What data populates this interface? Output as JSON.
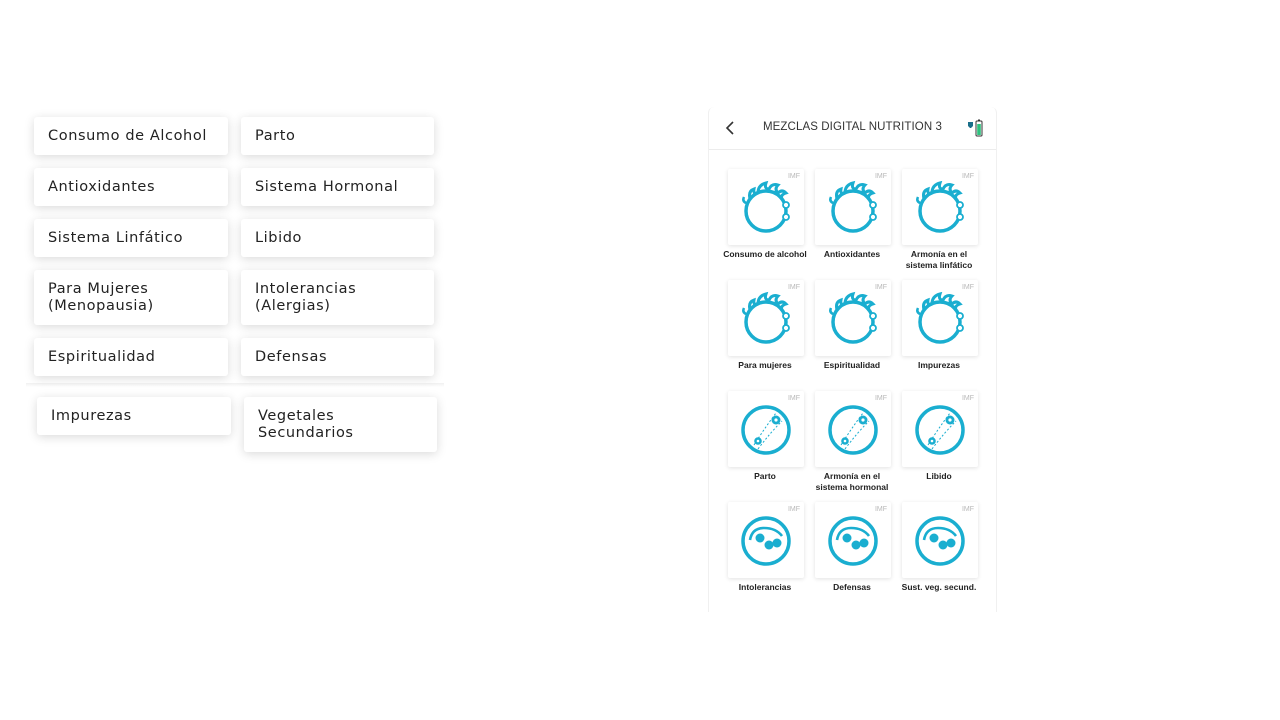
{
  "list_items": [
    {
      "label": "Consumo de Alcohol"
    },
    {
      "label": "Parto"
    },
    {
      "label": "Antioxidantes"
    },
    {
      "label": "Sistema Hormonal"
    },
    {
      "label": "Sistema Linfático"
    },
    {
      "label": "Libido"
    },
    {
      "label": "Para Mujeres\n(Menopausia)"
    },
    {
      "label": "Intolerancias\n(Alergias)"
    },
    {
      "label": "Espiritualidad"
    },
    {
      "label": "Defensas"
    },
    {
      "label": "Impurezas"
    },
    {
      "label": "Vegetales\nSecundarios"
    }
  ],
  "phone": {
    "title": "MEZCLAS DIGITAL NUTRITION 3",
    "back_icon": "chevron-left-icon",
    "device_icon": "bottle-battery-icon",
    "accent_color": "#1aaed0",
    "tiles": [
      {
        "label": "Consumo de alcohol",
        "tag": "IMF",
        "icon": "spiky-circle-icon"
      },
      {
        "label": "Antioxidantes",
        "tag": "IMF",
        "icon": "spiky-circle-icon"
      },
      {
        "label": "Armonía en el\nsistema linfático",
        "tag": "IMF",
        "icon": "spiky-circle-icon"
      },
      {
        "label": "Para mujeres",
        "tag": "IMF",
        "icon": "spiky-circle-icon"
      },
      {
        "label": "Espiritualidad",
        "tag": "IMF",
        "icon": "spiky-circle-icon"
      },
      {
        "label": "Impurezas",
        "tag": "IMF",
        "icon": "spiky-circle-icon"
      },
      {
        "label": "Parto",
        "tag": "IMF",
        "icon": "orbit-circle-icon"
      },
      {
        "label": "Armonía en el\nsistema hormonal",
        "tag": "IMF",
        "icon": "orbit-circle-icon"
      },
      {
        "label": "Libido",
        "tag": "IMF",
        "icon": "orbit-circle-icon"
      },
      {
        "label": "Intolerancias",
        "tag": "IMF",
        "icon": "cells-circle-icon"
      },
      {
        "label": "Defensas",
        "tag": "IMF",
        "icon": "cells-circle-icon"
      },
      {
        "label": "Sust. veg. secund.",
        "tag": "IMF",
        "icon": "cells-circle-icon"
      }
    ]
  }
}
